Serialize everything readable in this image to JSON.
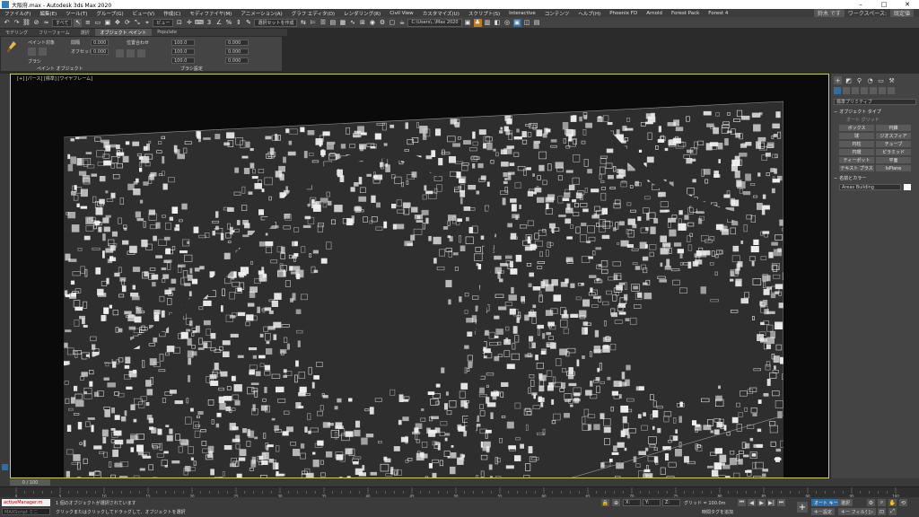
{
  "window": {
    "title": "大阪府.max - Autodesk 3ds Max 2020"
  },
  "menu": {
    "items": [
      "ファイル(F)",
      "編集(E)",
      "ツール(T)",
      "グループ(G)",
      "ビュー(V)",
      "作成(C)",
      "モディファイヤ(M)",
      "アニメーション(A)",
      "グラフ エディタ(D)",
      "レンダリング(R)",
      "Civil View",
      "カスタマイズ(U)",
      "スクリプト(S)",
      "Interactive",
      "コンテンツ",
      "ヘルプ(H)",
      "Phoenix FD",
      "Arnold",
      "Forest Pack",
      "Forest 4"
    ],
    "user": "鈴木 です",
    "workspace_label": "ワークスペース:",
    "workspace_value": "既定値"
  },
  "toolbar": {
    "filter_value": "すべて",
    "view_value": "ビュー",
    "selection_set": "選択セットを作成",
    "path_value": "C:\\Users\\..\\Max 2020"
  },
  "ribbon": {
    "tabs": [
      "モデリング",
      "フリーフォーム",
      "選択",
      "オブジェクト ペイント",
      "Populate"
    ],
    "active_tab": "オブジェクト ペイント",
    "paint_with": "ペイント対象",
    "brush_label": "ブラシ",
    "spacing_label": "間隔",
    "offset_label": "オフセット",
    "offset_value": "0.000",
    "spacing_value": "0.000",
    "align_label": "位置合わせ",
    "scale_x": "100.0",
    "scale_y": "100.0",
    "scale_z": "100.0",
    "rot_x": "0.000",
    "rot_y": "0.000",
    "rot_z": "0.000",
    "group_label": "ペイント オブジェクト",
    "brush_settings": "ブラシ設定"
  },
  "viewport": {
    "label": "[+] [パース] [標準] [ワイヤフレーム]"
  },
  "command_panel": {
    "category_value": "標準プリミティブ",
    "object_type_header": "オブジェクト タイプ",
    "autogrid": "オート グリッド",
    "buttons": [
      "ボックス",
      "円錐",
      "球",
      "ジオスフィア",
      "円柱",
      "チューブ",
      "円環",
      "ピラミッド",
      "ティーポット",
      "平面",
      "テキスト プラス",
      "IsPlane"
    ],
    "name_color_header": "名前とカラー",
    "object_name": "Areas Building"
  },
  "timeline": {
    "frame_display": "0 / 100",
    "ticks": [
      "0",
      "5",
      "10",
      "15",
      "20",
      "25",
      "30",
      "35",
      "40",
      "45",
      "50",
      "55",
      "60",
      "65",
      "70",
      "75",
      "80",
      "85",
      "90",
      "95",
      "100"
    ]
  },
  "status": {
    "script_listener": "activeManager.m",
    "maxscript": "MAXScript ミニ",
    "selection_info": "1 個のオブジェクトが選択されています",
    "hint": "クリックまたはクリックしてドラッグして、オブジェクトを選択",
    "grid": "グリッド = 100.0m",
    "time_tag": "時間タグを追加",
    "autokey": "オート キー",
    "set_key": "キー設定",
    "selected": "選択",
    "key_filters": "キー フィルタ..."
  },
  "colors": {
    "viewport_border": "#cfcf5a",
    "map_bg": "#2e2e2e",
    "map_building": "#f0f0f0",
    "accent_blue": "#2f6ea5"
  }
}
